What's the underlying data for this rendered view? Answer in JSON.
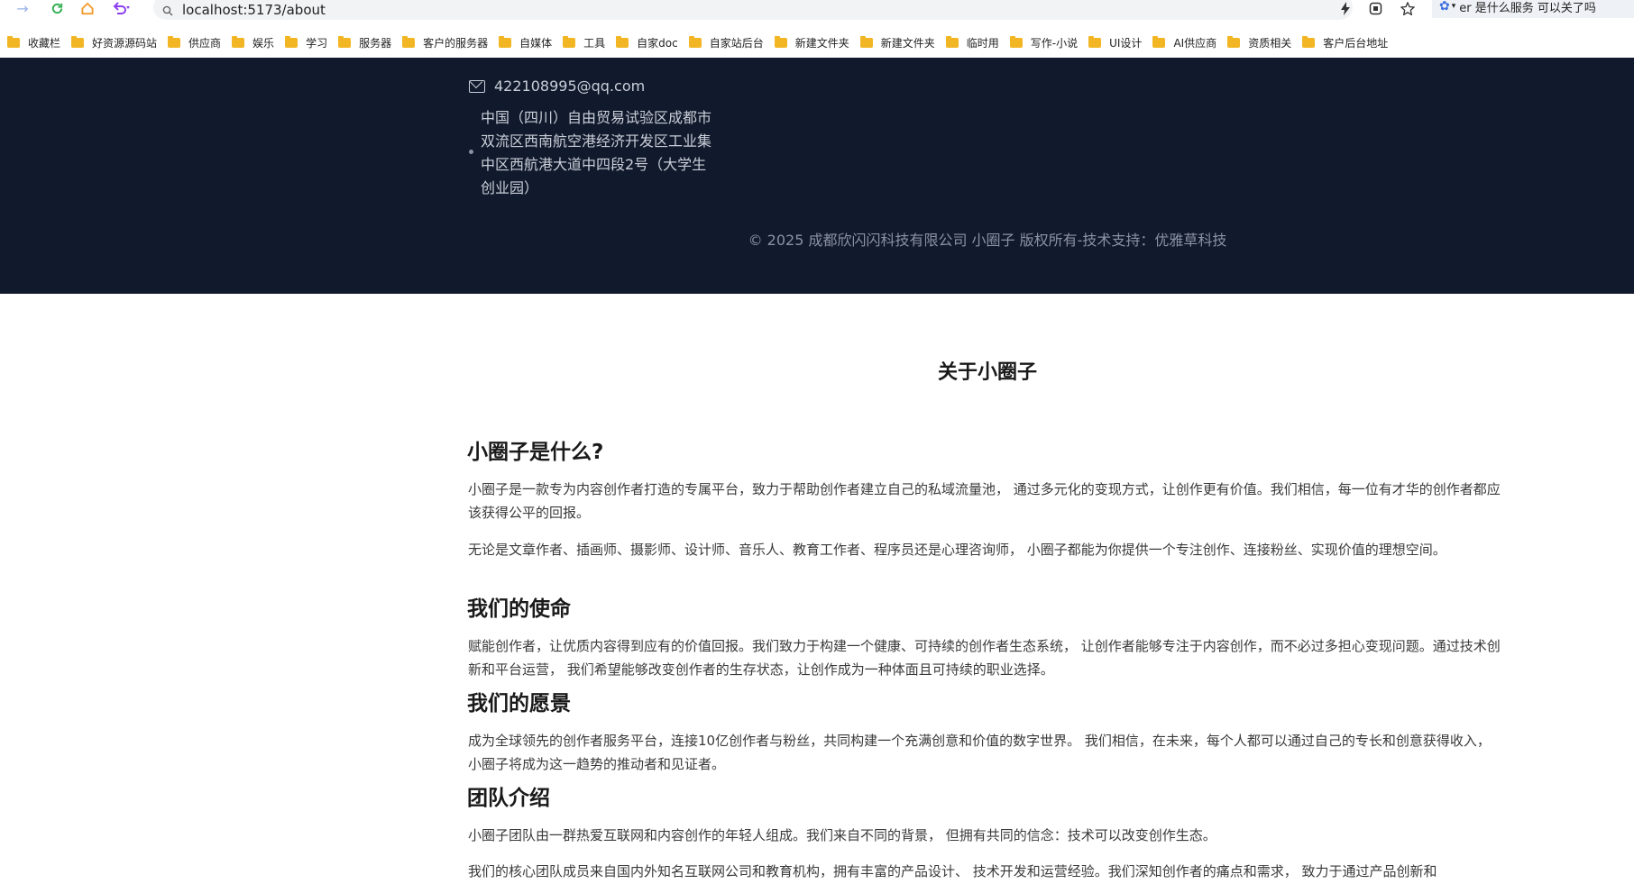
{
  "browser": {
    "url": "localhost:5173/about",
    "assistant_text": "er 是什么服务 可以关了吗"
  },
  "bookmarks": [
    "收藏栏",
    "好资源源码站",
    "供应商",
    "娱乐",
    "学习",
    "服务器",
    "客户的服务器",
    "自媒体",
    "工具",
    "自家doc",
    "自家站后台",
    "新建文件夹",
    "新建文件夹",
    "临时用",
    "写作-小说",
    "UI设计",
    "AI供应商",
    "资质相关",
    "客户后台地址"
  ],
  "footer": {
    "email": "422108995@qq.com",
    "address": "中国（四川）自由贸易试验区成都市双流区西南航空港经济开发区工业集中区西航港大道中四段2号（大学生创业园）",
    "copyright": "© 2025 成都欣闪闪科技有限公司 小圈子 版权所有-技术支持：优雅草科技"
  },
  "page": {
    "title": "关于小圈子",
    "sections": [
      {
        "heading": "小圈子是什么?",
        "paragraphs": [
          "小圈子是一款专为内容创作者打造的专属平台，致力于帮助创作者建立自己的私域流量池， 通过多元化的变现方式，让创作更有价值。我们相信，每一位有才华的创作者都应该获得公平的回报。",
          "无论是文章作者、插画师、摄影师、设计师、音乐人、教育工作者、程序员还是心理咨询师， 小圈子都能为你提供一个专注创作、连接粉丝、实现价值的理想空间。"
        ]
      },
      {
        "heading": "我们的使命",
        "paragraphs": [
          "赋能创作者，让优质内容得到应有的价值回报。我们致力于构建一个健康、可持续的创作者生态系统， 让创作者能够专注于内容创作，而不必过多担心变现问题。通过技术创新和平台运营， 我们希望能够改变创作者的生存状态，让创作成为一种体面且可持续的职业选择。"
        ]
      },
      {
        "heading": "我们的愿景",
        "paragraphs": [
          "成为全球领先的创作者服务平台，连接10亿创作者与粉丝，共同构建一个充满创意和价值的数字世界。 我们相信，在未来，每个人都可以通过自己的专长和创意获得收入， 小圈子将成为这一趋势的推动者和见证者。"
        ]
      },
      {
        "heading": "团队介绍",
        "paragraphs": [
          "小圈子团队由一群热爱互联网和内容创作的年轻人组成。我们来自不同的背景， 但拥有共同的信念：技术可以改变创作生态。",
          "我们的核心团队成员来自国内外知名互联网公司和教育机构，拥有丰富的产品设计、 技术开发和运营经验。我们深知创作者的痛点和需求， 致力于通过产品创新和"
        ]
      }
    ]
  }
}
